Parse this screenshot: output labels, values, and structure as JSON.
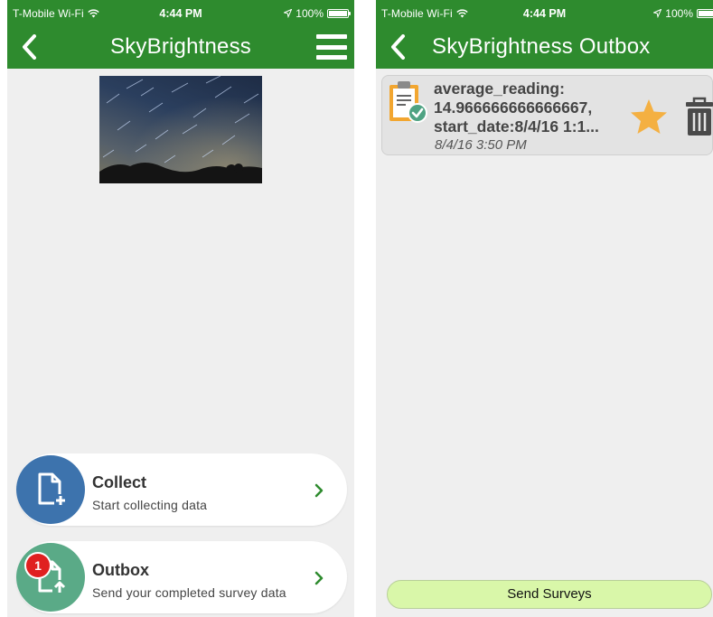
{
  "status_bar": {
    "carrier": "T-Mobile Wi-Fi",
    "time": "4:44 PM",
    "battery": "100%",
    "battery_level": 1.0
  },
  "home_screen": {
    "title": "SkyBrightness",
    "actions": [
      {
        "label": "Collect",
        "description": "Start collecting data",
        "icon": "add-document-icon"
      },
      {
        "label": "Outbox",
        "description": "Send your completed survey data",
        "icon": "upload-document-icon",
        "badge": "1"
      }
    ]
  },
  "outbox_screen": {
    "title": "SkyBrightness Outbox",
    "items": [
      {
        "line1": "average_reading:",
        "line2": "14.966666666666667,",
        "line3": "start_date:8/4/16 1:1...",
        "date": "8/4/16 3:50 PM"
      }
    ],
    "send_button": "Send Surveys"
  },
  "colors": {
    "header_green": "#2e8b2e",
    "collect_blue": "#3d73ad",
    "outbox_teal": "#5aaa87",
    "badge_red": "#e02020",
    "star_orange": "#f4b042",
    "send_button_green": "#d9f7a9"
  }
}
